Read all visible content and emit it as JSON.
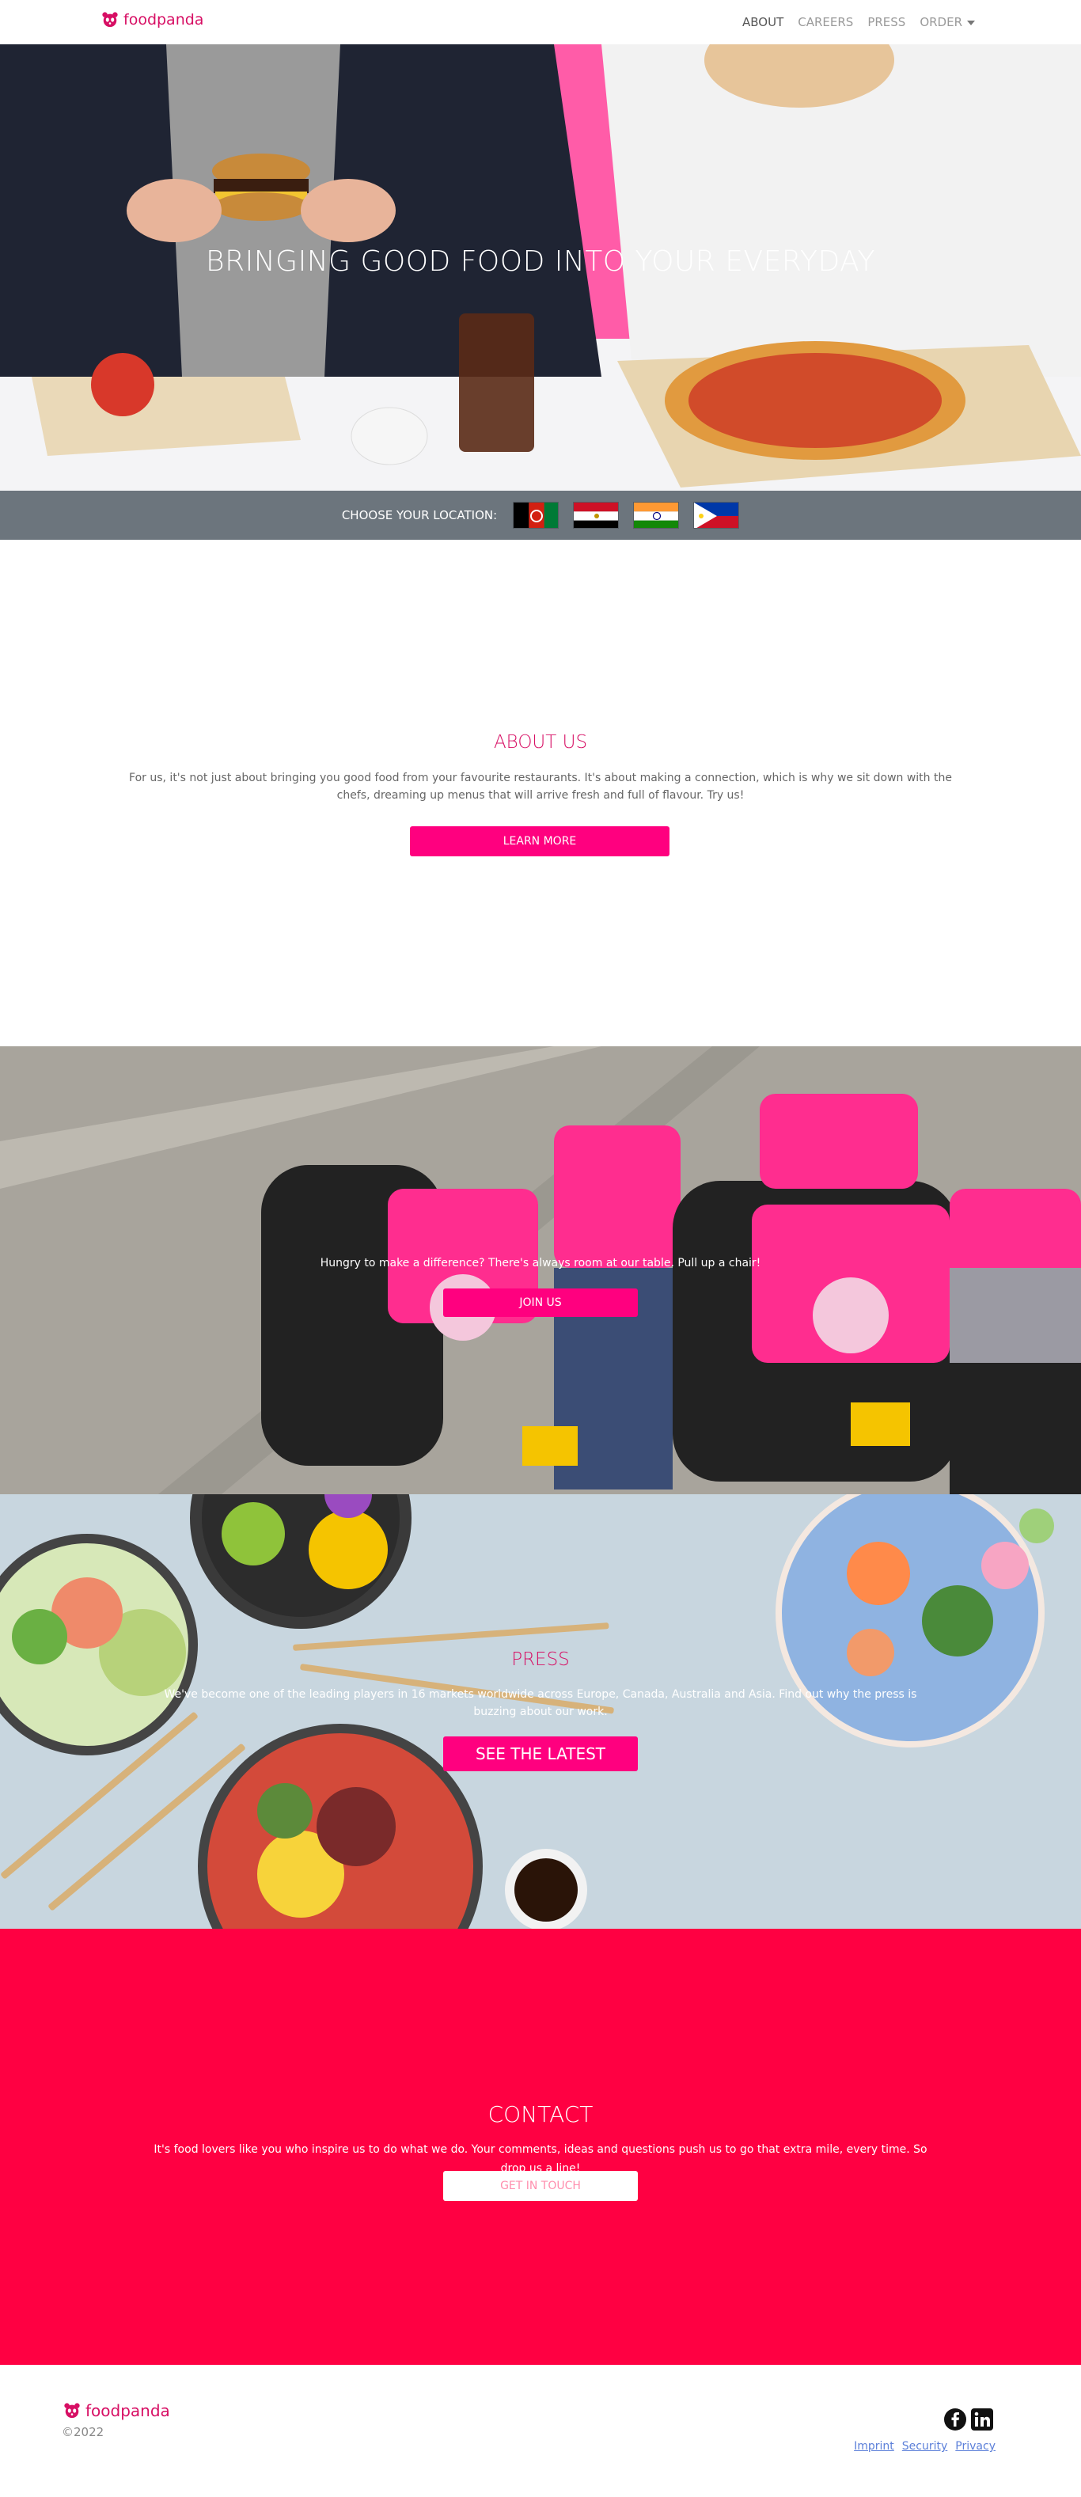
{
  "nav": {
    "brand": "foodpanda",
    "links": [
      {
        "label": "ABOUT"
      },
      {
        "label": "CAREERS"
      },
      {
        "label": "PRESS"
      },
      {
        "label": "ORDER"
      }
    ]
  },
  "hero": {
    "title": "BRINGING GOOD FOOD INTO YOUR EVERYDAY"
  },
  "location": {
    "label": "CHOOSE YOUR LOCATION:",
    "flags": [
      "afghanistan-flag-icon",
      "egypt-flag-icon",
      "india-flag-icon",
      "philippines-flag-icon"
    ]
  },
  "about": {
    "title": "ABOUT US",
    "text": "For us, it's not just about bringing you good food from your favourite restaurants. It's about making a connection, which is why we sit down with the chefs, dreaming up menus that will arrive fresh and full of flavour. Try us!",
    "button": "LEARN MORE"
  },
  "join": {
    "text": "Hungry to make a difference? There's always room at our table. Pull up a chair!",
    "button": "JOIN US"
  },
  "press": {
    "title": "PRESS",
    "text": "We've become one of the leading players in 16 markets worldwide across Europe, Canada, Australia and Asia. Find out why the press is buzzing about our work.",
    "button": "SEE THE LATEST"
  },
  "contact": {
    "title": "CONTACT",
    "text": "It's food lovers like you who inspire us to do what we do. Your comments, ideas and questions push us to go that extra mile, every time. So drop us a line!",
    "button": "GET IN TOUCH"
  },
  "footer": {
    "brand": "foodpanda",
    "copyright": "©2022",
    "links": [
      "Imprint",
      "Security",
      "Privacy"
    ]
  },
  "colors": {
    "brand": "#d70f64",
    "accent": "#ff007f",
    "contact_bg": "#ff0042",
    "location_bg": "#6c757d"
  }
}
